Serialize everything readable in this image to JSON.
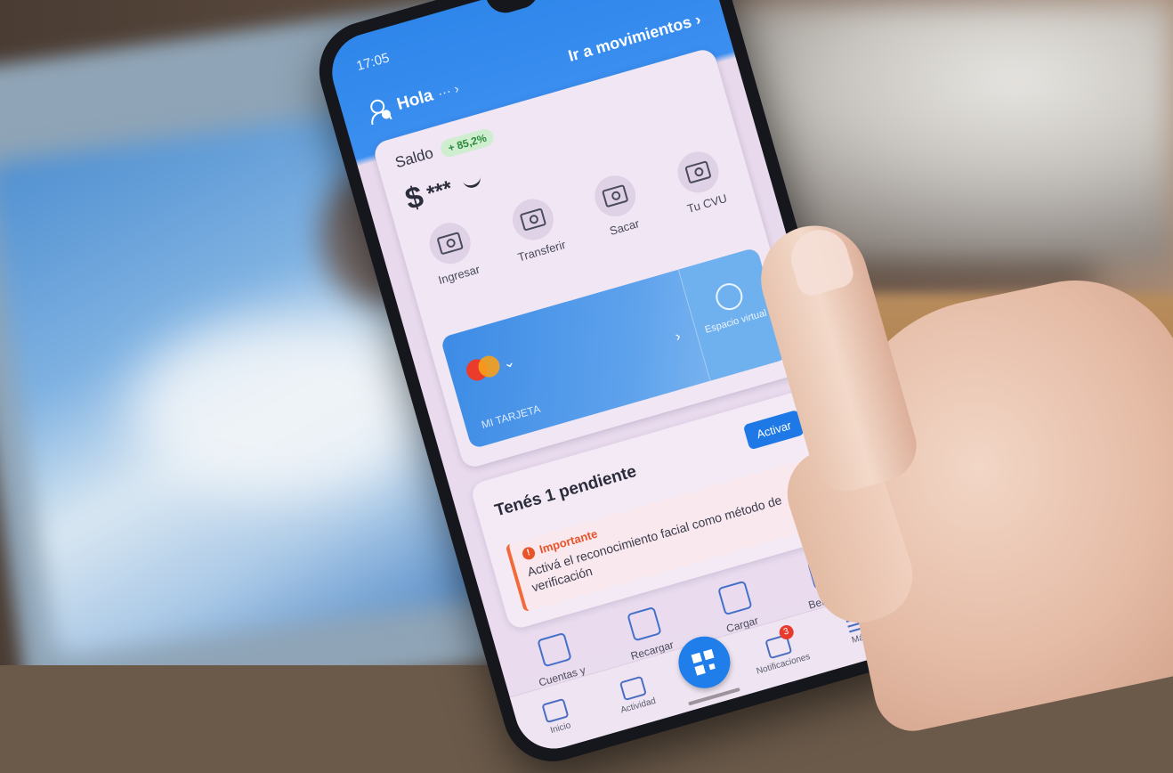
{
  "status_bar": {
    "time": "17:05"
  },
  "header": {
    "greeting": "Hola",
    "greeting_suffix": "··· ›",
    "movements_link": "Ir a movimientos ›"
  },
  "balance_card": {
    "saldo_label": "Saldo",
    "rate_badge": "+ 85,2%",
    "currency": "$",
    "balance_mask": "***",
    "actions": [
      {
        "label": "Ingresar",
        "icon": "deposit-icon"
      },
      {
        "label": "Transferir",
        "icon": "transfer-icon"
      },
      {
        "label": "Sacar",
        "icon": "withdraw-icon"
      },
      {
        "label": "Tu CVU",
        "icon": "id-card-icon"
      }
    ],
    "promo": {
      "side_label": "Espacio virtual",
      "footer": "MI TARJETA"
    }
  },
  "pending": {
    "title": "Tenés 1 pendiente",
    "button": "Activar",
    "alert_label": "Importante",
    "alert_text": "Activá el reconocimiento facial como método de verificación"
  },
  "shortcuts": [
    {
      "label": "Cuentas y servicios",
      "icon": "receipt-icon"
    },
    {
      "label": "Recargar celular",
      "icon": "phone-icon"
    },
    {
      "label": "Cargar transporte",
      "icon": "bus-icon"
    },
    {
      "label": "Beneficios",
      "icon": "percent-ticket-icon"
    }
  ],
  "bottom_nav": {
    "home": "Inicio",
    "activity": "Actividad",
    "notifications": "Notificaciones",
    "notification_count": "3",
    "menu": "Más"
  }
}
